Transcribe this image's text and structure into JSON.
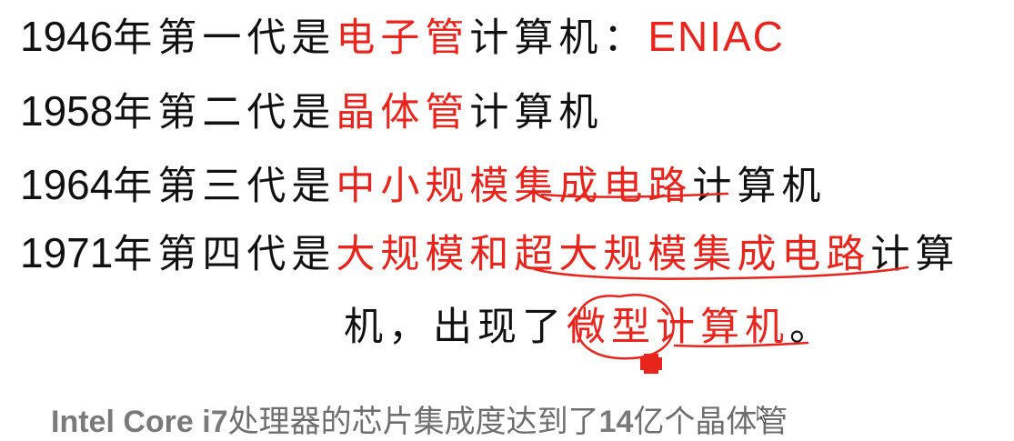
{
  "lines": [
    {
      "year": "1946",
      "pre": "年第一代是",
      "red": "电子管",
      "post": "计算机：",
      "post_red": "ENIAC"
    },
    {
      "year": "1958",
      "pre": "年第二代是",
      "red": "晶体管",
      "post": "计算机"
    },
    {
      "year": "1964",
      "pre": "年第三代是",
      "red": "中小规模集成电路",
      "post": "计算机"
    },
    {
      "year": "1971",
      "pre": "年第四代是",
      "red_a": "大规模和",
      "red_b": "超大规模集成电路",
      "post": "计算"
    },
    {
      "pre": "机，出现了",
      "red": "微型计算机",
      "post": "。"
    }
  ],
  "footer": {
    "brand": "Intel  Core i7",
    "text": "处理器的芯片集成度达到了",
    "number": "14",
    "tail": "亿个晶体管"
  },
  "colors": {
    "text": "#111111",
    "accent": "#e8241c",
    "footer": "#7a7a7a",
    "background": "#ffffff"
  },
  "icons": [
    "red-plus-pen-icon",
    "mouse-cursor-icon"
  ]
}
